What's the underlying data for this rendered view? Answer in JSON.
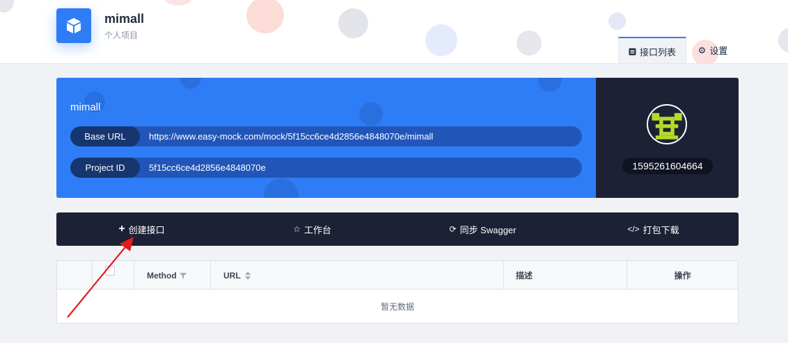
{
  "header": {
    "project_name": "mimall",
    "project_type": "个人项目",
    "tabs": [
      {
        "label": "接口列表",
        "icon": "list-icon"
      },
      {
        "label": "设置",
        "icon": "gear-icon"
      }
    ]
  },
  "info": {
    "name": "mimall",
    "base_url_label": "Base URL",
    "base_url_value": "https://www.easy-mock.com/mock/5f15cc6ce4d2856e4848070e/mimall",
    "project_id_label": "Project ID",
    "project_id_value": "5f15cc6ce4d2856e4848070e"
  },
  "user": {
    "id": "1595261604664"
  },
  "toolbar": {
    "create": "创建接口",
    "workbench": "工作台",
    "sync": "同步 Swagger",
    "download": "打包下载"
  },
  "table": {
    "columns": [
      "Method",
      "URL",
      "描述",
      "操作"
    ],
    "empty_text": "暂无数据"
  },
  "colors": {
    "accent": "#2f7df6",
    "dark": "#1c2136",
    "annotation_arrow": "#e31b1b"
  }
}
